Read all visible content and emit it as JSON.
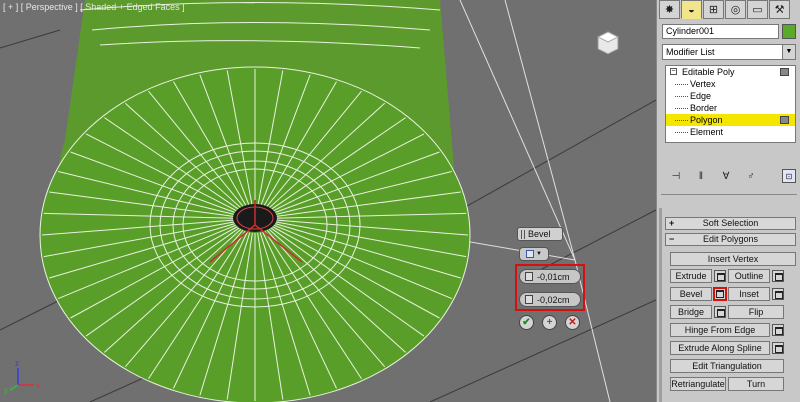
{
  "viewport": {
    "label": "[ + ] [ Perspective ] [ Shaded + Edged Faces ]"
  },
  "caddy": {
    "title": "Bevel",
    "height_value": "-0,01cm",
    "outline_value": "-0,02cm",
    "ok_glyph": "✔",
    "apply_glyph": "+",
    "cancel_glyph": "✕"
  },
  "panel": {
    "tabs": [
      "create-icon",
      "modify-icon",
      "hierarchy-icon",
      "motion-icon",
      "display-icon",
      "utilities-icon"
    ],
    "tab_glyphs": [
      "✸",
      "◒",
      "⊞",
      "◎",
      "▭",
      "⚒"
    ],
    "object_name": "Cylinder001",
    "object_color": "#5aaa2a",
    "modifier_list": "Modifier List",
    "stack": [
      {
        "label": "Editable Poly",
        "level": 0
      },
      {
        "label": "Vertex",
        "level": 1
      },
      {
        "label": "Edge",
        "level": 1
      },
      {
        "label": "Border",
        "level": 1
      },
      {
        "label": "Polygon",
        "level": 1,
        "selected": true
      },
      {
        "label": "Element",
        "level": 1
      }
    ],
    "stack_tool_glyphs": [
      "⊣",
      "ǁ",
      "∀",
      "♂",
      "⊡"
    ],
    "soft_selection": "Soft Selection",
    "edit_polygons": "Edit Polygons",
    "insert_vertex": "Insert Vertex",
    "extrude": "Extrude",
    "outline": "Outline",
    "bevel": "Bevel",
    "inset": "Inset",
    "bridge": "Bridge",
    "flip": "Flip",
    "hinge_from_edge": "Hinge From Edge",
    "extrude_along_spline": "Extrude Along Spline",
    "edit_triangulation": "Edit Triangulation",
    "retriangulate": "Retriangulate",
    "turn": "Turn",
    "expander_plus": "+",
    "expander_minus": "−"
  },
  "colors": {
    "mesh_green": "#5a9e2a",
    "highlight_red": "#d80f0f",
    "selected_yellow": "#f5e602"
  }
}
